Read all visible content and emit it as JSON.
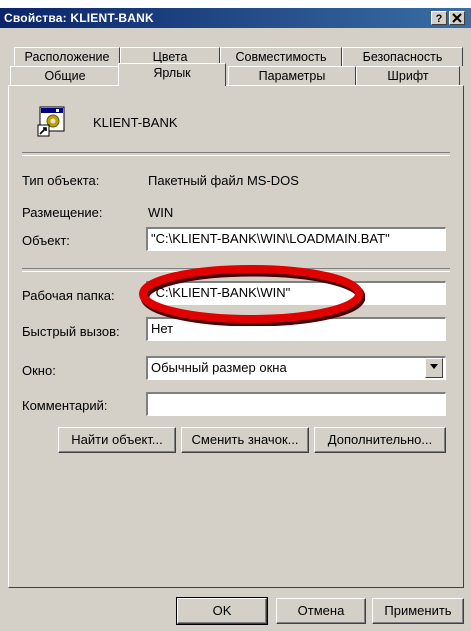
{
  "window": {
    "title": "Свойства: KLIENT-BANK"
  },
  "titlebar_buttons": {
    "help": "?",
    "close": "X"
  },
  "tabs_back": [
    "Расположение",
    "Цвета",
    "Совместимость",
    "Безопасность"
  ],
  "tabs_front": [
    "Общие",
    "Ярлык",
    "Параметры",
    "Шрифт"
  ],
  "header": {
    "name": "KLIENT-BANK",
    "icon": "batch-file-shortcut-icon"
  },
  "fields": {
    "type_label": "Тип объекта:",
    "type_value": "Пакетный файл MS-DOS",
    "location_label": "Размещение:",
    "location_value": "WIN",
    "target_label": "Объект:",
    "target_value": "\"C:\\KLIENT-BANK\\WIN\\LOADMAIN.BAT\"",
    "workdir_label": "Рабочая папка:",
    "workdir_value": "\"C:\\KLIENT-BANK\\WIN\"",
    "hotkey_label": "Быстрый вызов:",
    "hotkey_value": "Нет",
    "window_label": "Окно:",
    "window_value": "Обычный размер окна",
    "comment_label": "Комментарий:",
    "comment_value": ""
  },
  "buttons": {
    "find_target": "Найти объект...",
    "change_icon": "Сменить значок...",
    "advanced": "Дополнительно...",
    "ok": "OK",
    "cancel": "Отмена",
    "apply": "Применить"
  },
  "colors": {
    "titlebar": "#0a246a",
    "annotation": "#e00000",
    "face": "#d4d0c8"
  }
}
